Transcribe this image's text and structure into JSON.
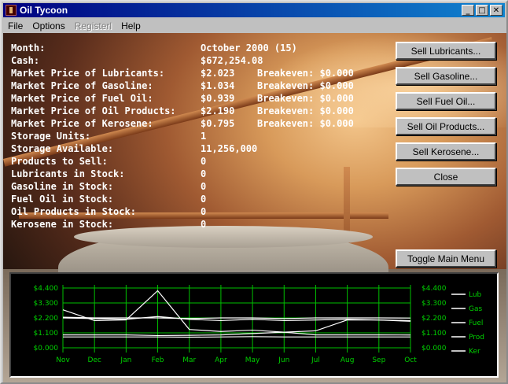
{
  "window": {
    "title": "Oil Tycoon"
  },
  "menu": [
    {
      "label": "File",
      "disabled": false
    },
    {
      "label": "Options",
      "disabled": false
    },
    {
      "label": "Registerl",
      "disabled": true
    },
    {
      "label": "Help",
      "disabled": false
    }
  ],
  "stats": [
    {
      "label": "Month:",
      "value": "October 2000 (15)",
      "extra": ""
    },
    {
      "label": "Cash:",
      "value": "$672,254.08",
      "extra": ""
    },
    {
      "label": "Market Price of Lubricants:",
      "value": "$2.023",
      "extra": "Breakeven: $0.000"
    },
    {
      "label": "Market Price of Gasoline:",
      "value": "$1.034",
      "extra": "Breakeven: $0.000"
    },
    {
      "label": "Market Price of Fuel Oil:",
      "value": "$0.939",
      "extra": "Breakeven: $0.000"
    },
    {
      "label": "Market Price of Oil Products:",
      "value": "$2.190",
      "extra": "Breakeven: $0.000"
    },
    {
      "label": "Market Price of Kerosene:",
      "value": "$0.795",
      "extra": "Breakeven: $0.000"
    },
    {
      "label": "Storage Units:",
      "value": "1",
      "extra": ""
    },
    {
      "label": "Storage Available:",
      "value": "11,256,000",
      "extra": ""
    },
    {
      "label": "Products to Sell:",
      "value": "0",
      "extra": ""
    },
    {
      "label": "Lubricants in Stock:",
      "value": "0",
      "extra": ""
    },
    {
      "label": "Gasoline in Stock:",
      "value": "0",
      "extra": ""
    },
    {
      "label": "Fuel Oil in Stock:",
      "value": "0",
      "extra": ""
    },
    {
      "label": "Oil Products in Stock:",
      "value": "0",
      "extra": ""
    },
    {
      "label": "Kerosene in Stock:",
      "value": "0",
      "extra": ""
    }
  ],
  "buttons": {
    "sell_lubricants": "Sell Lubricants...",
    "sell_gasoline": "Sell Gasoline...",
    "sell_fuel_oil": "Sell Fuel Oil...",
    "sell_oil_products": "Sell Oil Products...",
    "sell_kerosene": "Sell Kerosene...",
    "close": "Close",
    "toggle_main_menu": "Toggle Main Menu"
  },
  "chart_data": {
    "type": "line",
    "categories": [
      "Nov",
      "Dec",
      "Jan",
      "Feb",
      "Mar",
      "Apr",
      "May",
      "Jun",
      "Jul",
      "Aug",
      "Sep",
      "Oct"
    ],
    "y_ticks": [
      "$4.400",
      "$3.300",
      "$2.200",
      "$1.100",
      "$0.000"
    ],
    "ylim": [
      0,
      4.4
    ],
    "grid": true,
    "legend_position": "right",
    "series": [
      {
        "name": "Lub",
        "values": [
          2.8,
          2.0,
          2.05,
          4.2,
          1.35,
          1.2,
          1.3,
          1.15,
          1.25,
          2.05,
          2.05,
          1.95
        ]
      },
      {
        "name": "Gas",
        "values": [
          2.2,
          2.15,
          2.1,
          2.3,
          2.1,
          2.0,
          2.1,
          2.0,
          2.05,
          2.1,
          2.05,
          2.0
        ]
      },
      {
        "name": "Fuel",
        "values": [
          0.95,
          0.95,
          0.95,
          0.9,
          0.92,
          0.95,
          1.05,
          1.15,
          0.95,
          0.95,
          0.95,
          0.94
        ]
      },
      {
        "name": "Prod",
        "values": [
          2.25,
          2.2,
          2.2,
          2.2,
          2.15,
          2.2,
          2.2,
          2.15,
          2.2,
          2.2,
          2.2,
          2.19
        ]
      },
      {
        "name": "Ker",
        "values": [
          0.8,
          0.8,
          0.8,
          0.8,
          0.78,
          0.8,
          0.82,
          0.8,
          0.8,
          0.8,
          0.8,
          0.8
        ]
      }
    ],
    "colors": {
      "grid": "#00c000",
      "axis_text": "#00d000",
      "line": "#ffffff"
    }
  }
}
